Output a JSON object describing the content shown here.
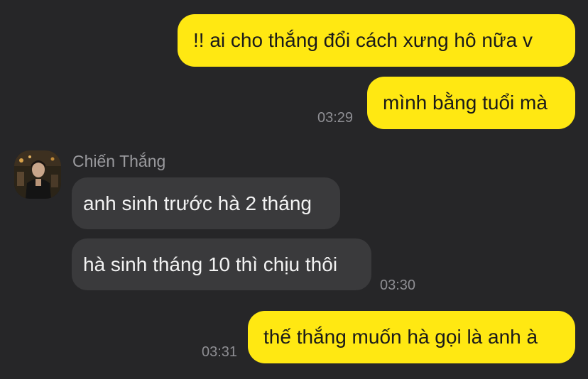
{
  "colors": {
    "background": "#262628",
    "outgoing_bubble": "#FFE812",
    "incoming_bubble": "#3a3a3c",
    "timestamp": "#8e8e93"
  },
  "messages": [
    {
      "direction": "outgoing",
      "text": "!! ai cho thắng đổi cách xưng hô nữa v"
    },
    {
      "direction": "outgoing",
      "text": "mình bằng tuổi mà",
      "time": "03:29"
    },
    {
      "direction": "incoming",
      "text": "anh sinh trước hà 2 tháng"
    },
    {
      "direction": "incoming",
      "text": "hà sinh tháng 10 thì chịu thôi",
      "time": "03:30"
    },
    {
      "direction": "outgoing",
      "text": "thế thắng muốn hà gọi là anh à",
      "time": "03:31"
    }
  ],
  "sender": {
    "name": "Chiến Thắng",
    "avatar_icon": "profile-photo"
  }
}
